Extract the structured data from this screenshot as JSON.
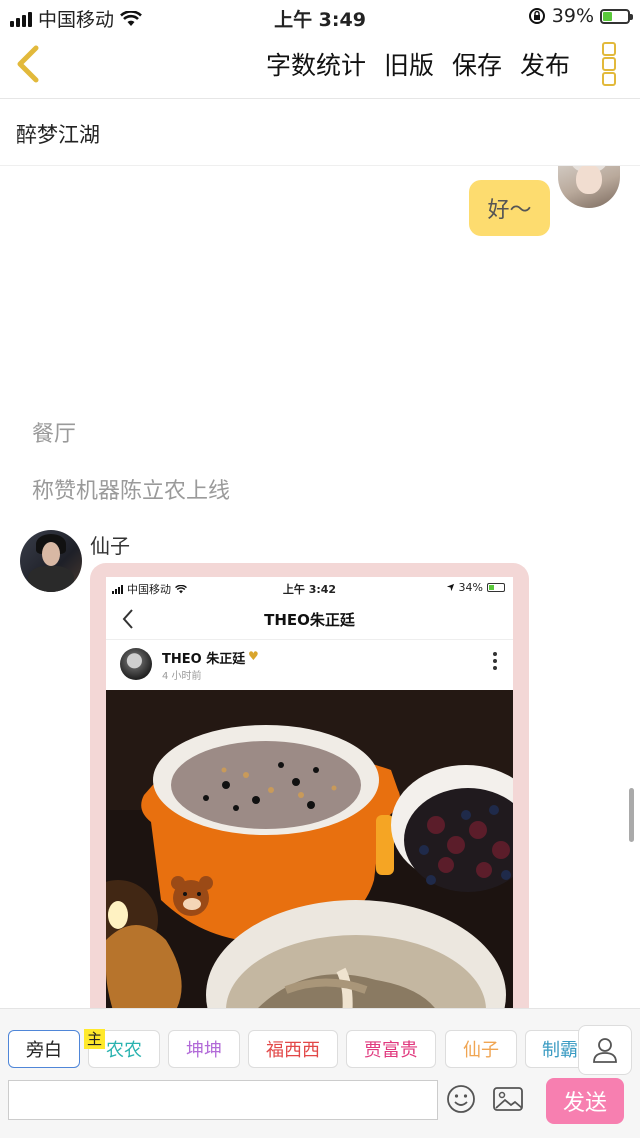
{
  "status_bar": {
    "carrier": "中国移动",
    "time": "上午 3:49",
    "battery": "39%",
    "battery_level": 0.39
  },
  "nav": {
    "actions": [
      "字数统计",
      "旧版",
      "保存",
      "发布"
    ]
  },
  "story_title": "醉梦江湖",
  "messages": {
    "right_bubble": "好～",
    "narration_1": "餐厅",
    "narration_2": "称赞机器陈立农上线",
    "sender": "仙子"
  },
  "embedded_screenshot": {
    "carrier": "中国移动",
    "time": "上午 3:42",
    "battery": "34%",
    "battery_level": 0.34,
    "title": "THEO朱正廷",
    "post_user": "THEO 朱正廷",
    "post_time": "4 小时前"
  },
  "roles": {
    "host_tag": "主",
    "chips": [
      {
        "label": "旁白",
        "color": "#222222"
      },
      {
        "label": "农农",
        "color": "#2ab3b0"
      },
      {
        "label": "坤坤",
        "color": "#b26ad8"
      },
      {
        "label": "福西西",
        "color": "#e24848"
      },
      {
        "label": "贾富贵",
        "color": "#e0397e"
      },
      {
        "label": "仙子",
        "color": "#f0a552"
      },
      {
        "label": "制霸",
        "color": "#3a9bc2"
      }
    ]
  },
  "input": {
    "placeholder": "",
    "send_label": "发送"
  },
  "colors": {
    "accent_yellow": "#fddc6f",
    "send_pink": "#f77fb0",
    "back_yellow": "#e2b93b"
  }
}
